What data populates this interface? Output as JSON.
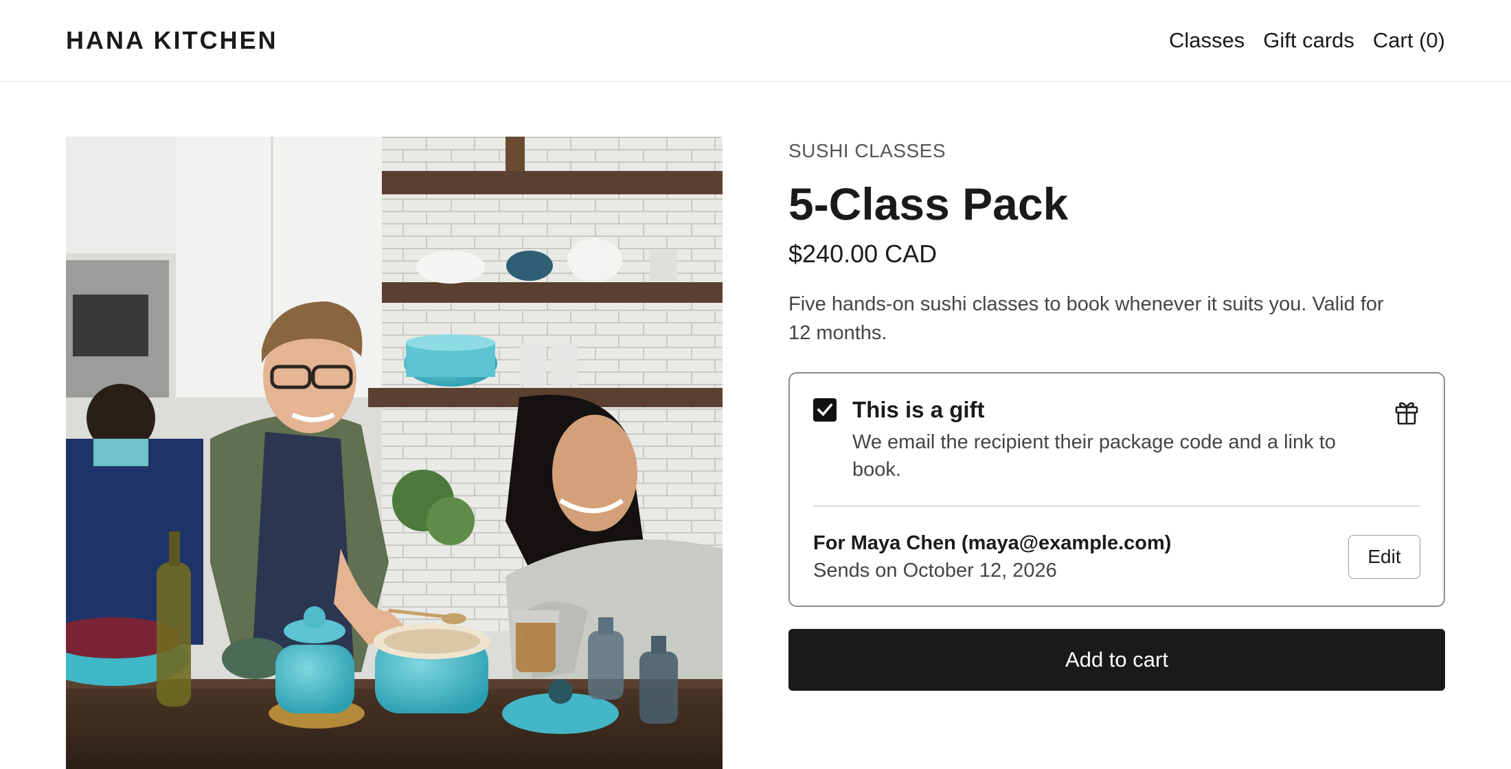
{
  "header": {
    "brand": "HANA KITCHEN",
    "nav": [
      "Classes",
      "Gift cards",
      "Cart (0)"
    ]
  },
  "product": {
    "image_alt": "Two people cooking together in a kitchen with turquoise cookware",
    "category": "SUSHI CLASSES",
    "title": "5-Class Pack",
    "price": "$240.00 CAD",
    "description": "Five hands-on sushi classes to book whenever it suits you. Valid for 12 months."
  },
  "gift": {
    "checked": true,
    "title": "This is a gift",
    "subtitle": "We email the recipient their package code and a link to book.",
    "icon": "gift-icon",
    "recipient": "For Maya Chen (maya@example.com)",
    "sends_on": "Sends on October 12, 2026",
    "edit_label": "Edit"
  },
  "actions": {
    "add_to_cart_label": "Add to cart"
  },
  "colors": {
    "text": "#1a1a1a",
    "muted": "#444444",
    "button_bg": "#1a1a1a",
    "cookware_accent": "#3fb8c8"
  }
}
